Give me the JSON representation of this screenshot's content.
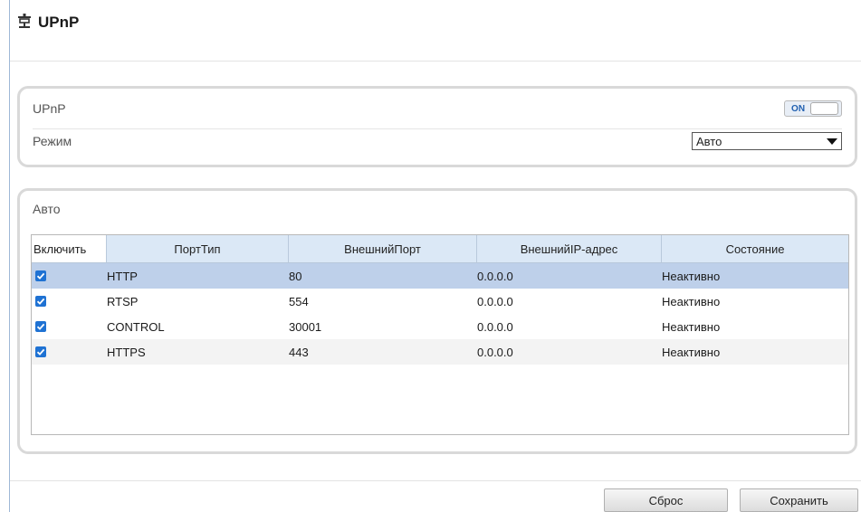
{
  "header": {
    "title": "UPnP",
    "icon": "network-plug-icon"
  },
  "settings": {
    "upnp_label": "UPnP",
    "toggle_text": "ON",
    "mode_label": "Режим",
    "mode_value": "Авто"
  },
  "auto_panel": {
    "label": "Авто"
  },
  "table": {
    "columns": [
      "Включить",
      "ПортТип",
      "ВнешнийПорт",
      "ВнешнийIP-адрес",
      "Состояние"
    ],
    "rows": [
      {
        "enabled": true,
        "type": "HTTP",
        "port": "80",
        "ip": "0.0.0.0",
        "status": "Неактивно"
      },
      {
        "enabled": true,
        "type": "RTSP",
        "port": "554",
        "ip": "0.0.0.0",
        "status": "Неактивно"
      },
      {
        "enabled": true,
        "type": "CONTROL",
        "port": "30001",
        "ip": "0.0.0.0",
        "status": "Неактивно"
      },
      {
        "enabled": true,
        "type": "HTTPS",
        "port": "443",
        "ip": "0.0.0.0",
        "status": "Неактивно"
      }
    ]
  },
  "buttons": {
    "reset": "Сброс",
    "save": "Сохранить"
  },
  "colors": {
    "accent": "#1f72d3",
    "selected_row": "#bed0ea",
    "header_bg": "#dbe8f6"
  }
}
